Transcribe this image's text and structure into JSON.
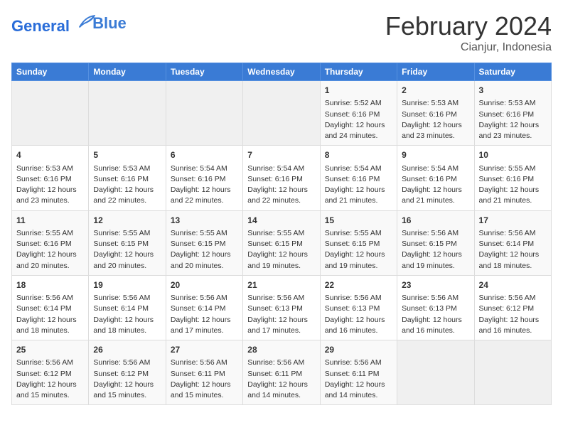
{
  "header": {
    "logo_line1": "General",
    "logo_line2": "Blue",
    "month": "February 2024",
    "location": "Cianjur, Indonesia"
  },
  "days_of_week": [
    "Sunday",
    "Monday",
    "Tuesday",
    "Wednesday",
    "Thursday",
    "Friday",
    "Saturday"
  ],
  "weeks": [
    [
      {
        "day": "",
        "info": ""
      },
      {
        "day": "",
        "info": ""
      },
      {
        "day": "",
        "info": ""
      },
      {
        "day": "",
        "info": ""
      },
      {
        "day": "1",
        "info": "Sunrise: 5:52 AM\nSunset: 6:16 PM\nDaylight: 12 hours\nand 24 minutes."
      },
      {
        "day": "2",
        "info": "Sunrise: 5:53 AM\nSunset: 6:16 PM\nDaylight: 12 hours\nand 23 minutes."
      },
      {
        "day": "3",
        "info": "Sunrise: 5:53 AM\nSunset: 6:16 PM\nDaylight: 12 hours\nand 23 minutes."
      }
    ],
    [
      {
        "day": "4",
        "info": "Sunrise: 5:53 AM\nSunset: 6:16 PM\nDaylight: 12 hours\nand 23 minutes."
      },
      {
        "day": "5",
        "info": "Sunrise: 5:53 AM\nSunset: 6:16 PM\nDaylight: 12 hours\nand 22 minutes."
      },
      {
        "day": "6",
        "info": "Sunrise: 5:54 AM\nSunset: 6:16 PM\nDaylight: 12 hours\nand 22 minutes."
      },
      {
        "day": "7",
        "info": "Sunrise: 5:54 AM\nSunset: 6:16 PM\nDaylight: 12 hours\nand 22 minutes."
      },
      {
        "day": "8",
        "info": "Sunrise: 5:54 AM\nSunset: 6:16 PM\nDaylight: 12 hours\nand 21 minutes."
      },
      {
        "day": "9",
        "info": "Sunrise: 5:54 AM\nSunset: 6:16 PM\nDaylight: 12 hours\nand 21 minutes."
      },
      {
        "day": "10",
        "info": "Sunrise: 5:55 AM\nSunset: 6:16 PM\nDaylight: 12 hours\nand 21 minutes."
      }
    ],
    [
      {
        "day": "11",
        "info": "Sunrise: 5:55 AM\nSunset: 6:16 PM\nDaylight: 12 hours\nand 20 minutes."
      },
      {
        "day": "12",
        "info": "Sunrise: 5:55 AM\nSunset: 6:15 PM\nDaylight: 12 hours\nand 20 minutes."
      },
      {
        "day": "13",
        "info": "Sunrise: 5:55 AM\nSunset: 6:15 PM\nDaylight: 12 hours\nand 20 minutes."
      },
      {
        "day": "14",
        "info": "Sunrise: 5:55 AM\nSunset: 6:15 PM\nDaylight: 12 hours\nand 19 minutes."
      },
      {
        "day": "15",
        "info": "Sunrise: 5:55 AM\nSunset: 6:15 PM\nDaylight: 12 hours\nand 19 minutes."
      },
      {
        "day": "16",
        "info": "Sunrise: 5:56 AM\nSunset: 6:15 PM\nDaylight: 12 hours\nand 19 minutes."
      },
      {
        "day": "17",
        "info": "Sunrise: 5:56 AM\nSunset: 6:14 PM\nDaylight: 12 hours\nand 18 minutes."
      }
    ],
    [
      {
        "day": "18",
        "info": "Sunrise: 5:56 AM\nSunset: 6:14 PM\nDaylight: 12 hours\nand 18 minutes."
      },
      {
        "day": "19",
        "info": "Sunrise: 5:56 AM\nSunset: 6:14 PM\nDaylight: 12 hours\nand 18 minutes."
      },
      {
        "day": "20",
        "info": "Sunrise: 5:56 AM\nSunset: 6:14 PM\nDaylight: 12 hours\nand 17 minutes."
      },
      {
        "day": "21",
        "info": "Sunrise: 5:56 AM\nSunset: 6:13 PM\nDaylight: 12 hours\nand 17 minutes."
      },
      {
        "day": "22",
        "info": "Sunrise: 5:56 AM\nSunset: 6:13 PM\nDaylight: 12 hours\nand 16 minutes."
      },
      {
        "day": "23",
        "info": "Sunrise: 5:56 AM\nSunset: 6:13 PM\nDaylight: 12 hours\nand 16 minutes."
      },
      {
        "day": "24",
        "info": "Sunrise: 5:56 AM\nSunset: 6:12 PM\nDaylight: 12 hours\nand 16 minutes."
      }
    ],
    [
      {
        "day": "25",
        "info": "Sunrise: 5:56 AM\nSunset: 6:12 PM\nDaylight: 12 hours\nand 15 minutes."
      },
      {
        "day": "26",
        "info": "Sunrise: 5:56 AM\nSunset: 6:12 PM\nDaylight: 12 hours\nand 15 minutes."
      },
      {
        "day": "27",
        "info": "Sunrise: 5:56 AM\nSunset: 6:11 PM\nDaylight: 12 hours\nand 15 minutes."
      },
      {
        "day": "28",
        "info": "Sunrise: 5:56 AM\nSunset: 6:11 PM\nDaylight: 12 hours\nand 14 minutes."
      },
      {
        "day": "29",
        "info": "Sunrise: 5:56 AM\nSunset: 6:11 PM\nDaylight: 12 hours\nand 14 minutes."
      },
      {
        "day": "",
        "info": ""
      },
      {
        "day": "",
        "info": ""
      }
    ]
  ]
}
